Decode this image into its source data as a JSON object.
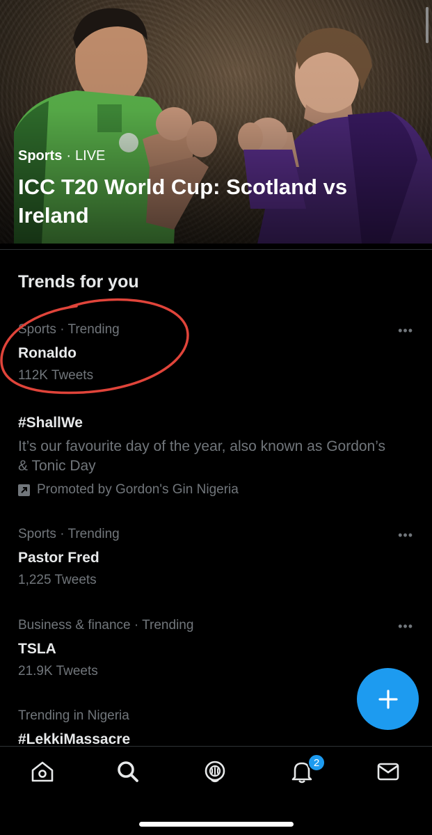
{
  "hero": {
    "category": "Sports",
    "separator": "·",
    "live_label": "LIVE",
    "title": "ICC T20 World Cup: Scotland vs Ireland"
  },
  "trends": {
    "section_title": "Trends for you",
    "items": [
      {
        "meta": "Sports · Trending",
        "name": "Ronaldo",
        "count": "112K Tweets",
        "more": "•••"
      },
      {
        "name": "#ShallWe",
        "description": "It’s our favourite day of the year, also known as Gordon’s & Tonic Day",
        "promoted": "Promoted by Gordon's Gin Nigeria"
      },
      {
        "meta": "Sports · Trending",
        "name": "Pastor Fred",
        "count": "1,225 Tweets",
        "more": "•••"
      },
      {
        "meta": "Business & finance · Trending",
        "name": "TSLA",
        "count": "21.9K Tweets",
        "more": "•••"
      },
      {
        "meta": "Trending in Nigeria",
        "name": "#LekkiMassacre"
      }
    ]
  },
  "tabbar": {
    "icons": [
      "home-icon",
      "search-icon",
      "spaces-icon",
      "notifications-icon",
      "messages-icon"
    ],
    "notification_count": "2"
  },
  "colors": {
    "accent": "#1d9bf0",
    "background": "#000000",
    "secondary_text": "#71767b",
    "annotation": "#e0443a"
  }
}
